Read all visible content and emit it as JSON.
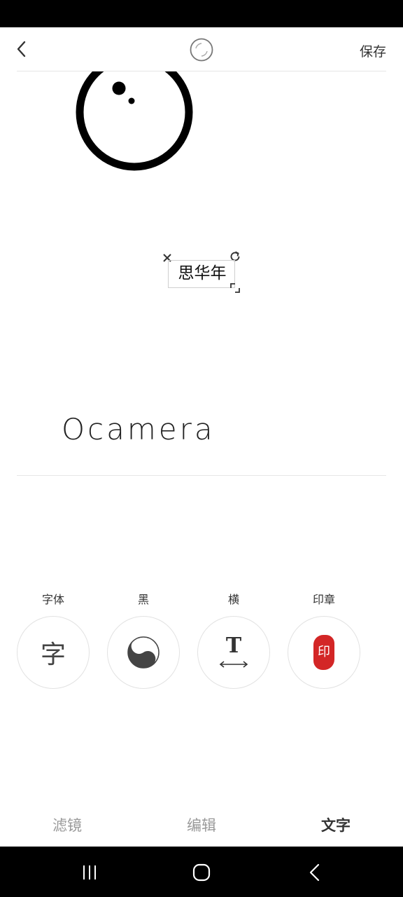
{
  "header": {
    "save_label": "保存"
  },
  "canvas": {
    "text_sticker": "思华年",
    "brand_text": "Ocamera"
  },
  "tools": [
    {
      "label": "字体",
      "glyph": "字",
      "icon": "font-character-icon"
    },
    {
      "label": "黑",
      "icon": "yin-yang-icon"
    },
    {
      "label": "横",
      "glyph": "T",
      "icon": "horizontal-text-icon"
    },
    {
      "label": "印章",
      "glyph": "印",
      "icon": "red-seal-stamp-icon",
      "seal_color": "#d32626"
    }
  ],
  "tabs": [
    {
      "label": "滤镜",
      "active": false
    },
    {
      "label": "编辑",
      "active": false
    },
    {
      "label": "文字",
      "active": true
    }
  ],
  "colors": {
    "accent_text": "#333333",
    "inactive_tab": "#999999",
    "seal_red": "#d32626"
  }
}
